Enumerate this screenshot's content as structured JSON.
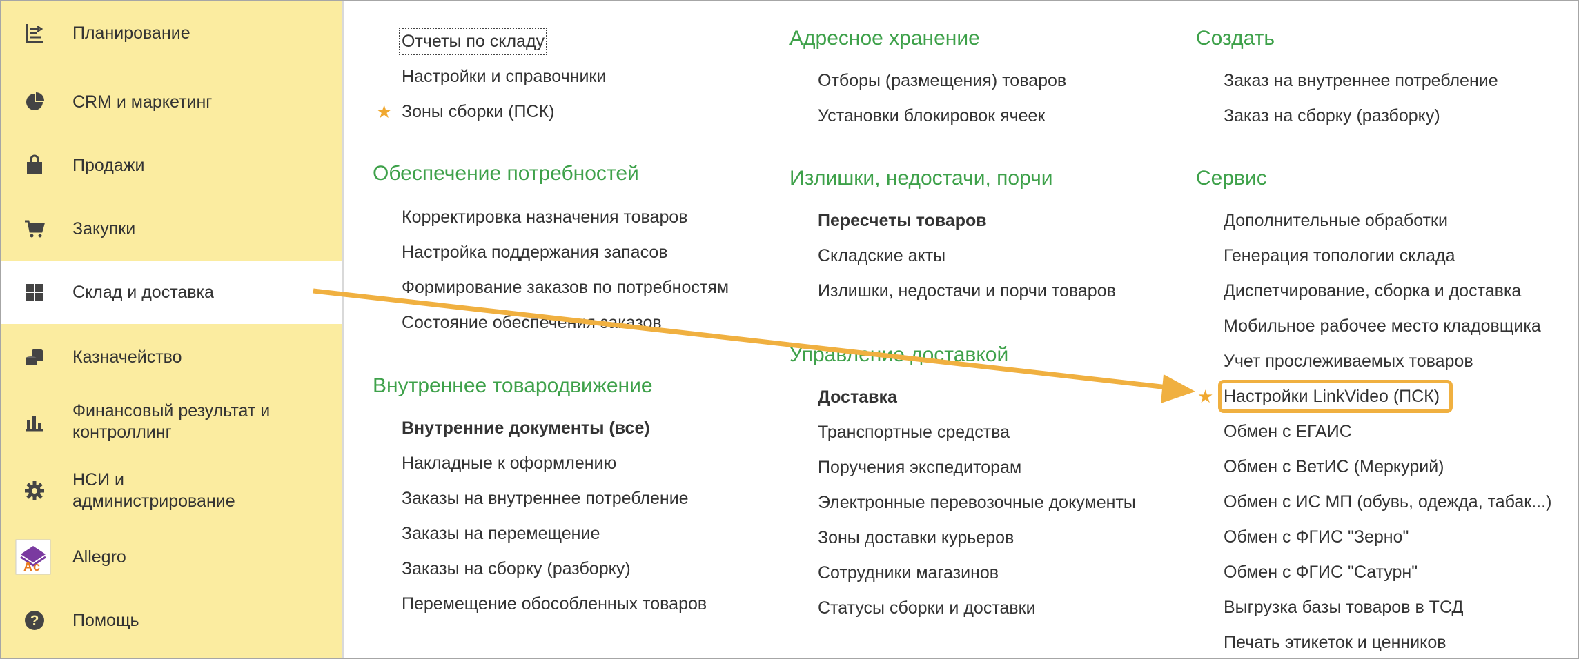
{
  "sidebar": {
    "items": [
      {
        "label": "Планирование",
        "icon": "planning-icon"
      },
      {
        "label": "CRM и маркетинг",
        "icon": "pie-chart-icon"
      },
      {
        "label": "Продажи",
        "icon": "shopping-bag-icon"
      },
      {
        "label": "Закупки",
        "icon": "shopping-cart-icon"
      },
      {
        "label": "Склад и доставка",
        "icon": "warehouse-grid-icon",
        "active": true
      },
      {
        "label": "Казначейство",
        "icon": "coins-icon"
      },
      {
        "label": "Финансовый результат и\nконтроллинг",
        "icon": "bar-chart-icon"
      },
      {
        "label": "НСИ и\nадминистрирование",
        "icon": "gear-icon"
      },
      {
        "label": "Allegro",
        "icon": "allegro-logo-icon"
      },
      {
        "label": "Помощь",
        "icon": "help-icon"
      }
    ]
  },
  "col1": {
    "top_links": [
      "Отчеты по складу",
      "Настройки и справочники",
      "Зоны сборки (ПСК)"
    ],
    "groups": [
      {
        "title": "Обеспечение потребностей",
        "links": [
          "Корректировка назначения товаров",
          "Настройка поддержания запасов",
          "Формирование заказов по потребностям",
          "Состояние обеспечения заказов"
        ]
      },
      {
        "title": "Внутреннее товародвижение",
        "links": [
          "Внутренние документы (все)",
          "Накладные к оформлению",
          "Заказы на внутреннее потребление",
          "Заказы на перемещение",
          "Заказы на сборку (разборку)",
          "Перемещение обособленных товаров"
        ]
      }
    ]
  },
  "col2": {
    "groups": [
      {
        "title": "Адресное хранение",
        "links": [
          "Отборы (размещения) товаров",
          "Установки блокировок ячеек"
        ]
      },
      {
        "title": "Излишки, недостачи, порчи",
        "links": [
          "Пересчеты товаров",
          "Складские акты",
          "Излишки, недостачи и порчи товаров"
        ]
      },
      {
        "title": "Управление доставкой",
        "links": [
          "Доставка",
          "Транспортные средства",
          "Поручения экспедиторам",
          "Электронные перевозочные документы",
          "Зоны доставки курьеров",
          "Сотрудники магазинов",
          "Статусы сборки и доставки"
        ]
      }
    ]
  },
  "col3": {
    "groups": [
      {
        "title": "Создать",
        "links": [
          "Заказ на внутреннее потребление",
          "Заказ на сборку (разборку)"
        ]
      },
      {
        "title": "Сервис",
        "links": [
          "Дополнительные обработки",
          "Генерация топологии склада",
          "Диспетчирование, сборка и доставка",
          "Мобильное рабочее место кладовщика",
          "Учет прослеживаемых товаров",
          "Настройки LinkVideo (ПСК)",
          "Обмен с ЕГАИС",
          "Обмен с ВетИС (Меркурий)",
          "Обмен с ИС МП (обувь, одежда, табак...)",
          "Обмен с ФГИС \"Зерно\"",
          "Обмен с ФГИС \"Сатурн\"",
          "Выгрузка базы товаров в ТСД",
          "Печать этикеток и ценников"
        ]
      }
    ]
  },
  "colors": {
    "sidebar_bg": "#fbeca0",
    "group_title": "#3ea14a",
    "star": "#f0a830",
    "arrow": "#f0b040"
  }
}
